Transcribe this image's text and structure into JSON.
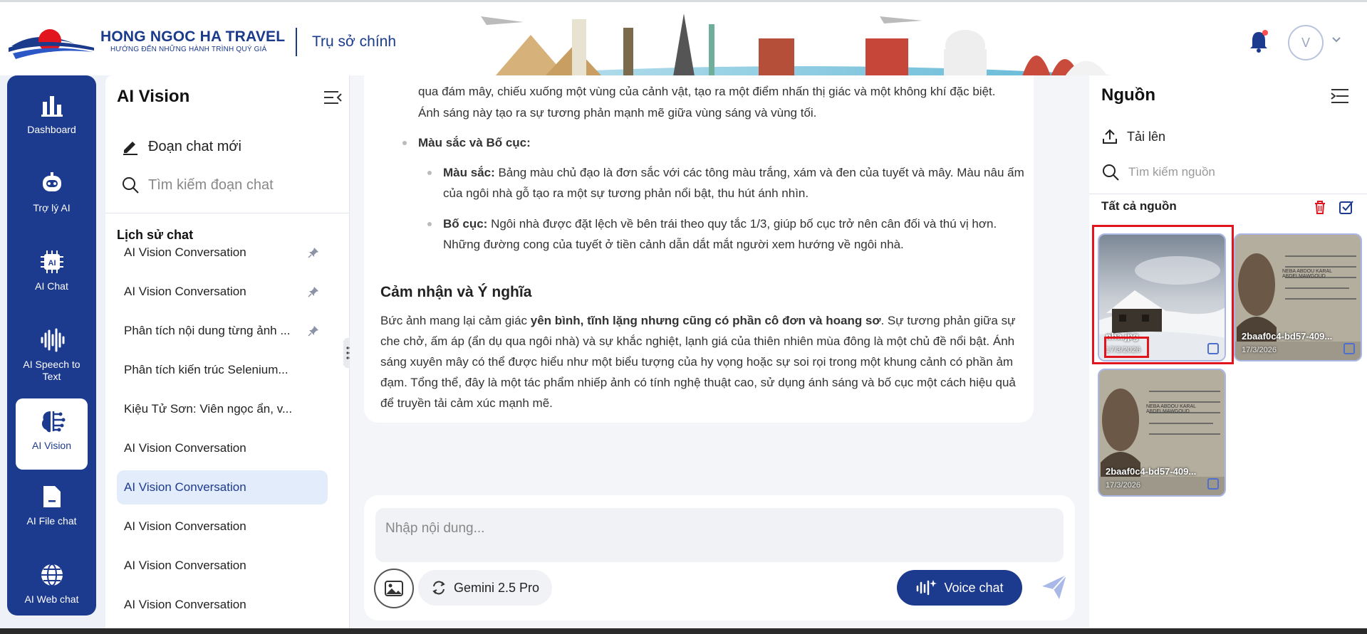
{
  "header": {
    "brand_name": "HONG NGOC HA TRAVEL",
    "brand_slogan": "HƯỚNG ĐẾN NHỮNG HÀNH TRÌNH QUÝ GIÁ",
    "office_label": "Trụ sở chính",
    "avatar_initial": "V"
  },
  "nav": [
    {
      "label": "Dashboard",
      "icon": "bar-chart-icon"
    },
    {
      "label": "Trợ lý AI",
      "icon": "robot-icon"
    },
    {
      "label": "AI Chat",
      "icon": "ai-chip-icon"
    },
    {
      "label": "AI Speech to Text",
      "icon": "soundwave-icon"
    },
    {
      "label": "AI Vision",
      "icon": "brain-icon",
      "active": true
    },
    {
      "label": "AI File chat",
      "icon": "file-icon"
    },
    {
      "label": "AI Web chat",
      "icon": "globe-icon"
    }
  ],
  "sidebar": {
    "title": "AI Vision",
    "new_chat": "Đoạn chat mới",
    "search_placeholder": "Tìm kiếm đoạn chat",
    "history_title": "Lịch sử chat",
    "history": [
      {
        "label": "AI Vision Conversation",
        "pinned": true
      },
      {
        "label": "AI Vision Conversation",
        "pinned": true
      },
      {
        "label": "Phân tích nội dung từng ảnh ...",
        "pinned": true
      },
      {
        "label": "Phân tích kiến trúc Selenium...",
        "pinned": false
      },
      {
        "label": "Kiệu Tử Sơn: Viên ngọc ẩn, v...",
        "pinned": false
      },
      {
        "label": "AI Vision Conversation",
        "pinned": false
      },
      {
        "label": "AI Vision Conversation",
        "pinned": false,
        "active": true
      },
      {
        "label": "AI Vision Conversation",
        "pinned": false
      },
      {
        "label": "AI Vision Conversation",
        "pinned": false
      },
      {
        "label": "AI Vision Conversation",
        "pinned": false
      }
    ]
  },
  "answer": {
    "light_line1": "qua đám mây, chiếu xuống một vùng của cảnh vật, tạo ra một điểm nhấn thị giác và một không khí đặc biệt.",
    "light_line2": "Ánh sáng này tạo ra sự tương phản mạnh mẽ giữa vùng sáng và vùng tối.",
    "color_comp_heading": "Màu sắc và Bố cục:",
    "color_label": "Màu sắc:",
    "color_text": " Bảng màu chủ đạo là đơn sắc với các tông màu trắng, xám và đen của tuyết và mây. Màu nâu ấm của ngôi nhà gỗ tạo ra một sự tương phản nổi bật, thu hút ánh nhìn.",
    "comp_label": "Bố cục:",
    "comp_text": " Ngôi nhà được đặt lệch về bên trái theo quy tắc 1/3, giúp bố cục trở nên cân đối và thú vị hơn. Những đường cong của tuyết ở tiền cảnh dẫn dắt mắt người xem hướng về ngôi nhà.",
    "section_title": "Cảm nhận và Ý nghĩa",
    "para_start": "Bức ảnh mang lại cảm giác ",
    "para_bold": "yên bình, tĩnh lặng nhưng cũng có phần cô đơn và hoang sơ",
    "para_end": ". Sự tương phản giữa sự che chở, ấm áp (ẩn dụ qua ngôi nhà) và sự khắc nghiệt, lạnh giá của thiên nhiên mùa đông là một chủ đề nổi bật. Ánh sáng xuyên mây có thể được hiểu như một biểu tượng của hy vọng hoặc sự soi rọi trong một khung cảnh có phần ảm đạm. Tổng thể, đây là một tác phẩm nhiếp ảnh có tính nghệ thuật cao, sử dụng ánh sáng và bố cục một cách hiệu quả để truyền tải cảm xúc mạnh mẽ."
  },
  "composer": {
    "placeholder": "Nhập nội dung...",
    "model": "Gemini 2.5 Pro",
    "voice_label": "Voice chat"
  },
  "sources": {
    "title": "Nguồn",
    "upload": "Tải lên",
    "search_placeholder": "Tìm kiếm nguồn",
    "all_label": "Tất cả nguồn",
    "items": [
      {
        "name": "nha.jpg",
        "date": "17/3/2026",
        "kind": "snow-house"
      },
      {
        "name": "2baaf0c4-bd57-409...",
        "date": "17/3/2026",
        "kind": "id-card"
      },
      {
        "name": "2baaf0c4-bd57-409...",
        "date": "17/3/2026",
        "kind": "id-card"
      }
    ],
    "card_mrz": "NEBA ABDOU KARAL ABDELMAWGOUD"
  },
  "colors": {
    "primary": "#1d3b8e",
    "highlight": "#e2141e",
    "notification": "#ff4d4f"
  }
}
